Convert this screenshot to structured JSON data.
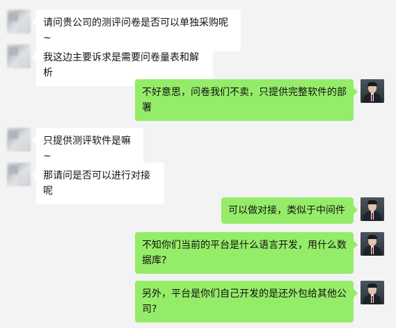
{
  "messages": [
    {
      "side": "left",
      "text": "请问贵公司的测评问卷是否可以单独采购呢~"
    },
    {
      "side": "left",
      "text": "我这边主要诉求是需要问卷量表和解析"
    },
    {
      "side": "right",
      "text": "不好意思，问卷我们不卖，只提供完整软件的部署"
    },
    {
      "side": "left",
      "text": "只提供测评软件是嘛~"
    },
    {
      "side": "left",
      "text": "那请问是否可以进行对接呢"
    },
    {
      "side": "right",
      "text": "可以做对接，类似于中间件"
    },
    {
      "side": "right",
      "text": "不知你们当前的平台是什么语言开发，用什么数据库?"
    },
    {
      "side": "right",
      "text": "另外，平台是你们自己开发的是还外包给其他公司?"
    }
  ],
  "colors": {
    "background": "#f3f3f3",
    "incoming_bubble": "#ffffff",
    "outgoing_bubble": "#95ec69"
  },
  "icons": {
    "customer_avatar": "blurred-avatar-icon",
    "agent_avatar": "agent-portrait-icon"
  }
}
